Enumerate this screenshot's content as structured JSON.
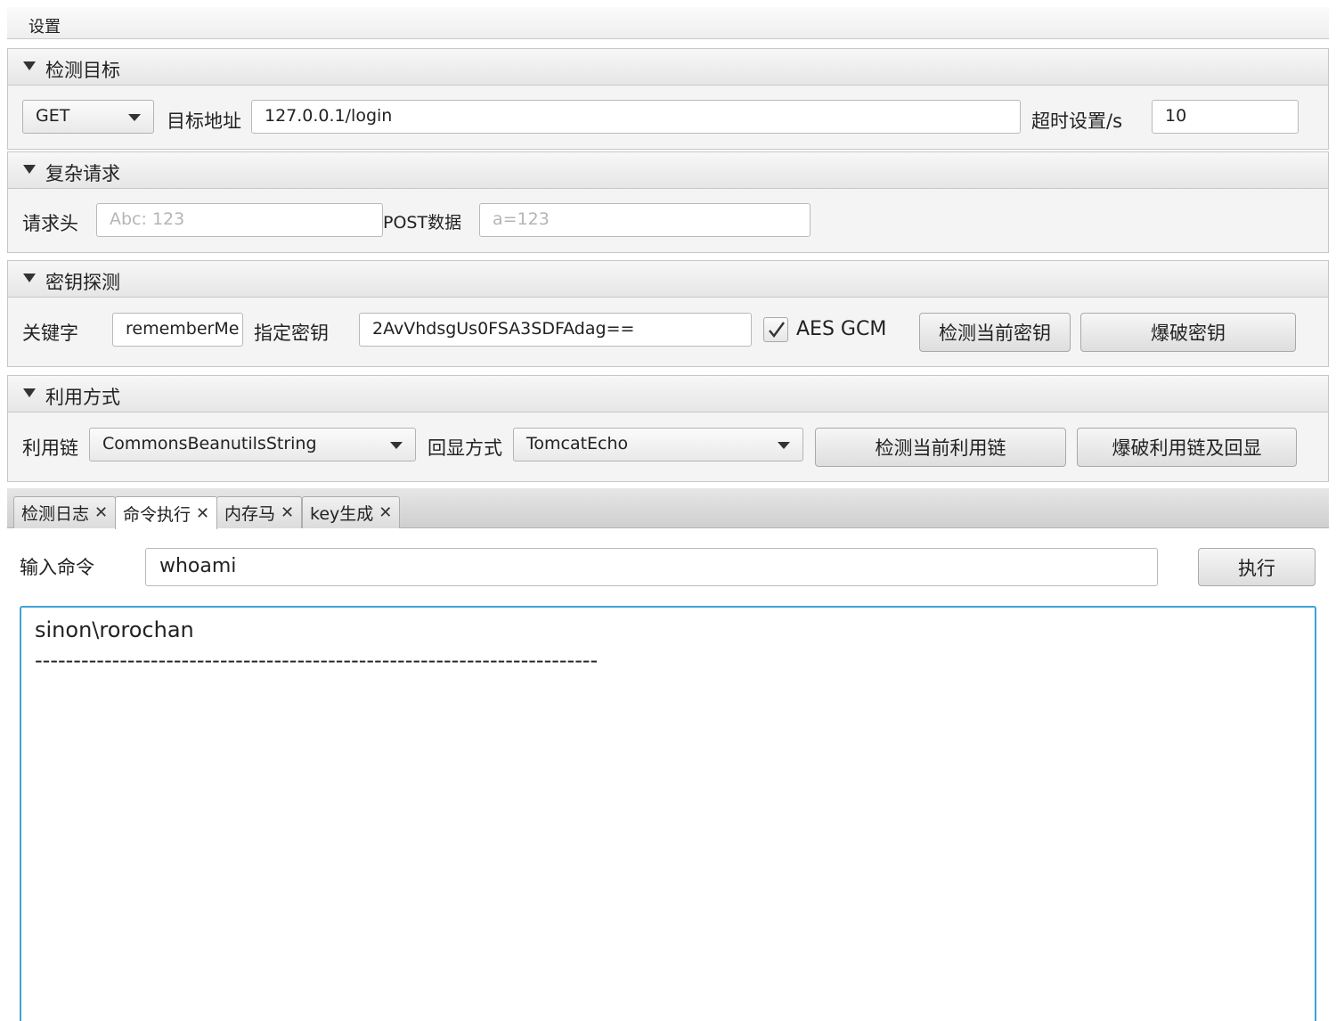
{
  "menu": {
    "settings": "设置"
  },
  "target_pane": {
    "title": "检测目标",
    "method": "GET",
    "url_label": "目标地址",
    "url_value": "127.0.0.1/login",
    "timeout_label": "超时设置/s",
    "timeout_value": "10"
  },
  "complex_pane": {
    "title": "复杂请求",
    "header_label": "请求头",
    "header_placeholder": "Abc: 123",
    "post_label": "POST数据",
    "post_placeholder": "a=123"
  },
  "key_pane": {
    "title": "密钥探测",
    "keyword_label": "关键字",
    "keyword_value": "rememberMe",
    "key_label": "指定密钥",
    "key_value": "2AvVhdsgUs0FSA3SDFAdag==",
    "aes_gcm_label": "AES GCM",
    "aes_gcm_checked": true,
    "check_key_button": "检测当前密钥",
    "brute_key_button": "爆破密钥"
  },
  "exploit_pane": {
    "title": "利用方式",
    "chain_label": "利用链",
    "chain_value": "CommonsBeanutilsString",
    "echo_label": "回显方式",
    "echo_value": "TomcatEcho",
    "check_chain_button": "检测当前利用链",
    "brute_chain_button": "爆破利用链及回显"
  },
  "tabs": [
    {
      "label": "检测日志",
      "active": false
    },
    {
      "label": "命令执行",
      "active": true
    },
    {
      "label": "内存马",
      "active": false
    },
    {
      "label": "key生成",
      "active": false
    }
  ],
  "command": {
    "label": "输入命令",
    "value": "whoami",
    "execute_button": "执行",
    "output_line1": "sinon\\rorochan",
    "output_line2": "-------------------------------------------------------------------------"
  }
}
